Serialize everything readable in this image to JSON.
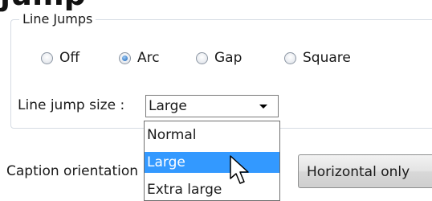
{
  "banner": {
    "text": "...",
    "text_bold": "jump",
    "tail": "..."
  },
  "line_jumps": {
    "title": "Line Jumps",
    "options": [
      {
        "label": "Off",
        "checked": false
      },
      {
        "label": "Arc",
        "checked": true
      },
      {
        "label": "Gap",
        "checked": false
      },
      {
        "label": "Square",
        "checked": false
      }
    ],
    "size_label": "Line jump size :",
    "size_value": "Large",
    "size_options": [
      "Normal",
      "Large",
      "Extra large"
    ],
    "highlighted_option": "Large"
  },
  "caption": {
    "label": "Caption orientation",
    "button_label": "Horizontal only"
  },
  "colors": {
    "selection": "#3399ff",
    "group_border": "#d5dbe3"
  }
}
